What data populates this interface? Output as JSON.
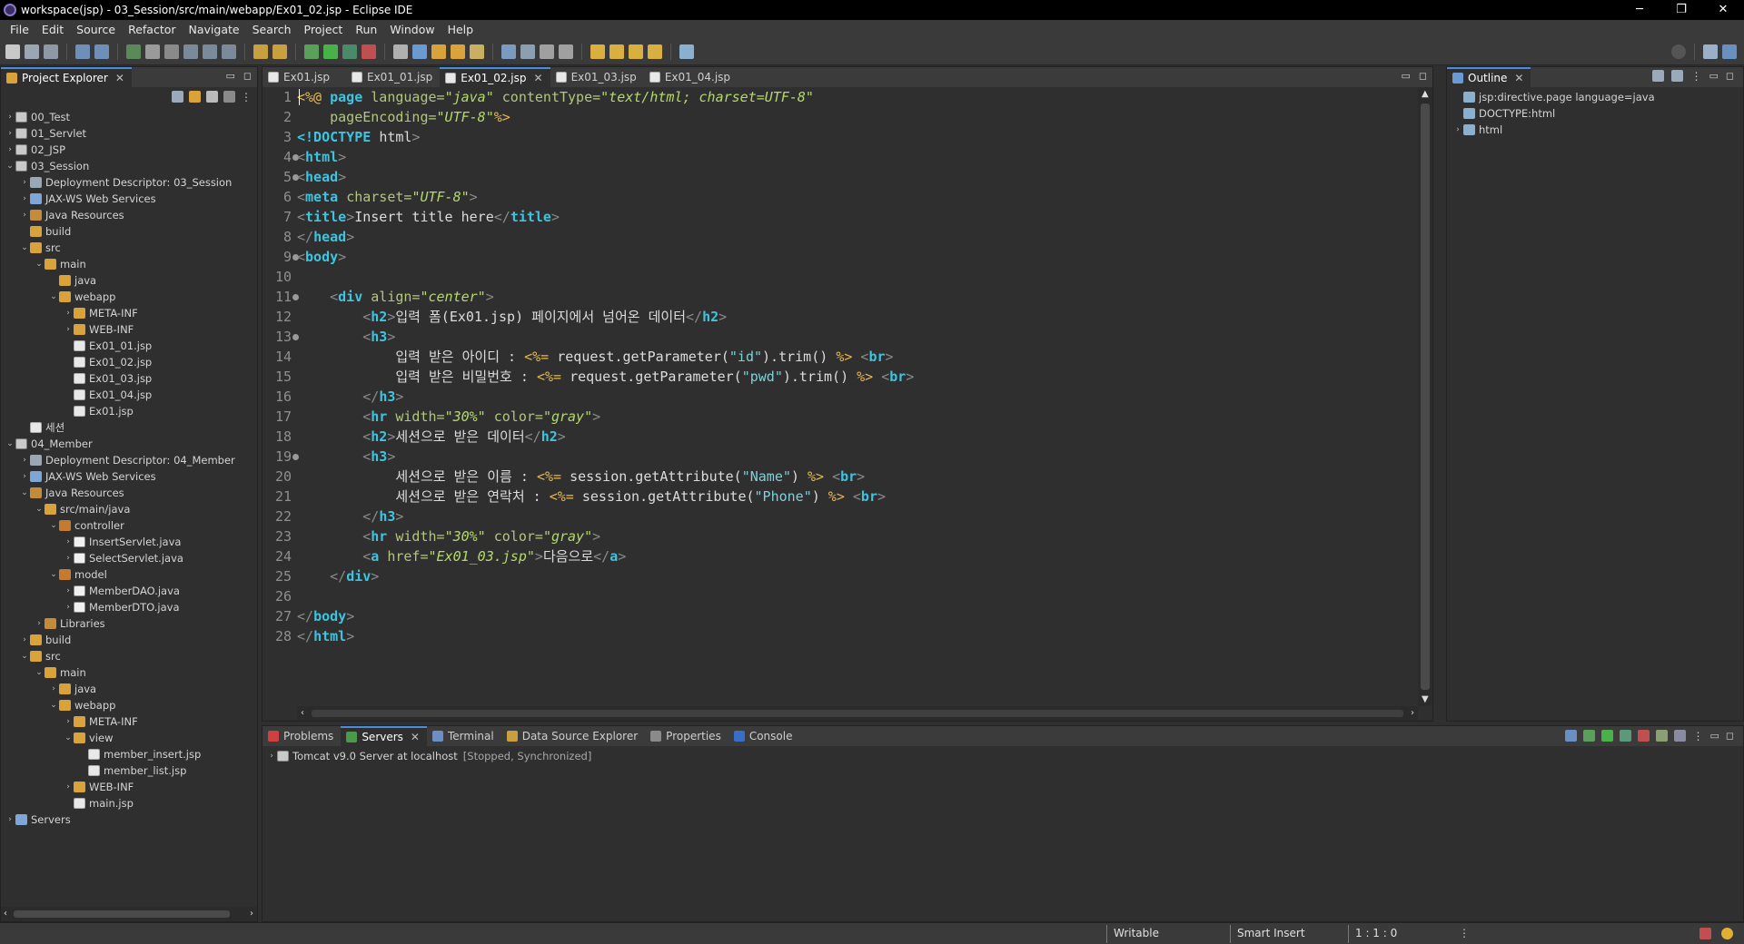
{
  "window": {
    "title": "workspace(jsp) - 03_Session/src/main/webapp/Ex01_02.jsp - Eclipse IDE",
    "controls": [
      "─",
      "❐",
      "✕"
    ]
  },
  "menu": [
    "File",
    "Edit",
    "Source",
    "Refactor",
    "Navigate",
    "Search",
    "Project",
    "Run",
    "Window",
    "Help"
  ],
  "project_explorer": {
    "title": "Project Explorer",
    "tree": [
      {
        "label": "00_Test",
        "indent": 0,
        "chev": "›",
        "icon": "proj"
      },
      {
        "label": "01_Servlet",
        "indent": 0,
        "chev": "›",
        "icon": "proj"
      },
      {
        "label": "02_JSP",
        "indent": 0,
        "chev": "›",
        "icon": "proj"
      },
      {
        "label": "03_Session",
        "indent": 0,
        "chev": "⌄",
        "icon": "proj"
      },
      {
        "label": "Deployment Descriptor: 03_Session",
        "indent": 1,
        "chev": "›",
        "icon": "dd"
      },
      {
        "label": "JAX-WS Web Services",
        "indent": 1,
        "chev": "›",
        "icon": "srv"
      },
      {
        "label": "Java Resources",
        "indent": 1,
        "chev": "›",
        "icon": "lib"
      },
      {
        "label": "build",
        "indent": 1,
        "chev": "",
        "icon": "folder"
      },
      {
        "label": "src",
        "indent": 1,
        "chev": "⌄",
        "icon": "folder"
      },
      {
        "label": "main",
        "indent": 2,
        "chev": "⌄",
        "icon": "folder"
      },
      {
        "label": "java",
        "indent": 3,
        "chev": "",
        "icon": "folder"
      },
      {
        "label": "webapp",
        "indent": 3,
        "chev": "⌄",
        "icon": "folder"
      },
      {
        "label": "META-INF",
        "indent": 4,
        "chev": "›",
        "icon": "folder"
      },
      {
        "label": "WEB-INF",
        "indent": 4,
        "chev": "›",
        "icon": "folder"
      },
      {
        "label": "Ex01_01.jsp",
        "indent": 4,
        "chev": "",
        "icon": "file-jsp"
      },
      {
        "label": "Ex01_02.jsp",
        "indent": 4,
        "chev": "",
        "icon": "file-jsp"
      },
      {
        "label": "Ex01_03.jsp",
        "indent": 4,
        "chev": "",
        "icon": "file-jsp"
      },
      {
        "label": "Ex01_04.jsp",
        "indent": 4,
        "chev": "",
        "icon": "file-jsp"
      },
      {
        "label": "Ex01.jsp",
        "indent": 4,
        "chev": "",
        "icon": "file-jsp"
      },
      {
        "label": "세션",
        "indent": 1,
        "chev": "",
        "icon": "file-jsp"
      },
      {
        "label": "04_Member",
        "indent": 0,
        "chev": "⌄",
        "icon": "proj"
      },
      {
        "label": "Deployment Descriptor: 04_Member",
        "indent": 1,
        "chev": "›",
        "icon": "dd"
      },
      {
        "label": "JAX-WS Web Services",
        "indent": 1,
        "chev": "›",
        "icon": "srv"
      },
      {
        "label": "Java Resources",
        "indent": 1,
        "chev": "⌄",
        "icon": "lib"
      },
      {
        "label": "src/main/java",
        "indent": 2,
        "chev": "⌄",
        "icon": "folder"
      },
      {
        "label": "controller",
        "indent": 3,
        "chev": "⌄",
        "icon": "pkg"
      },
      {
        "label": "InsertServlet.java",
        "indent": 4,
        "chev": "›",
        "icon": "file-java"
      },
      {
        "label": "SelectServlet.java",
        "indent": 4,
        "chev": "›",
        "icon": "file-java"
      },
      {
        "label": "model",
        "indent": 3,
        "chev": "⌄",
        "icon": "pkg"
      },
      {
        "label": "MemberDAO.java",
        "indent": 4,
        "chev": "›",
        "icon": "file-java"
      },
      {
        "label": "MemberDTO.java",
        "indent": 4,
        "chev": "›",
        "icon": "file-java"
      },
      {
        "label": "Libraries",
        "indent": 2,
        "chev": "›",
        "icon": "lib"
      },
      {
        "label": "build",
        "indent": 1,
        "chev": "›",
        "icon": "folder"
      },
      {
        "label": "src",
        "indent": 1,
        "chev": "⌄",
        "icon": "folder"
      },
      {
        "label": "main",
        "indent": 2,
        "chev": "⌄",
        "icon": "folder"
      },
      {
        "label": "java",
        "indent": 3,
        "chev": "›",
        "icon": "folder"
      },
      {
        "label": "webapp",
        "indent": 3,
        "chev": "⌄",
        "icon": "folder"
      },
      {
        "label": "META-INF",
        "indent": 4,
        "chev": "›",
        "icon": "folder"
      },
      {
        "label": "view",
        "indent": 4,
        "chev": "⌄",
        "icon": "folder"
      },
      {
        "label": "member_insert.jsp",
        "indent": 5,
        "chev": "",
        "icon": "file-jsp"
      },
      {
        "label": "member_list.jsp",
        "indent": 5,
        "chev": "",
        "icon": "file-jsp"
      },
      {
        "label": "WEB-INF",
        "indent": 4,
        "chev": "›",
        "icon": "folder"
      },
      {
        "label": "main.jsp",
        "indent": 4,
        "chev": "",
        "icon": "file-jsp"
      },
      {
        "label": "Servers",
        "indent": 0,
        "chev": "›",
        "icon": "srv"
      }
    ]
  },
  "editor": {
    "tabs": [
      {
        "label": "Ex01.jsp",
        "active": false
      },
      {
        "label": "Ex01_01.jsp",
        "active": false
      },
      {
        "label": "Ex01_02.jsp",
        "active": true
      },
      {
        "label": "Ex01_03.jsp",
        "active": false
      },
      {
        "label": "Ex01_04.jsp",
        "active": false
      }
    ],
    "fold_lines": [
      4,
      5,
      9,
      11,
      13,
      19
    ],
    "lines": [
      [
        [
          "jsp",
          "<%@ "
        ],
        [
          "dir",
          "page "
        ],
        [
          "attr",
          "language="
        ],
        [
          "val",
          "\"java\" "
        ],
        [
          "attr",
          "contentType="
        ],
        [
          "val",
          "\"text/html; charset=UTF-8\""
        ]
      ],
      [
        [
          "txt",
          "    "
        ],
        [
          "attr",
          "pageEncoding="
        ],
        [
          "val",
          "\"UTF-8\""
        ],
        [
          "jsp",
          "%>"
        ]
      ],
      [
        [
          "doc",
          "<!DOCTYPE "
        ],
        [
          "txt",
          "html"
        ],
        [
          "br",
          ">"
        ]
      ],
      [
        [
          "br",
          "<"
        ],
        [
          "tag",
          "html"
        ],
        [
          "br",
          ">"
        ]
      ],
      [
        [
          "br",
          "<"
        ],
        [
          "tag",
          "head"
        ],
        [
          "br",
          ">"
        ]
      ],
      [
        [
          "br",
          "<"
        ],
        [
          "tag",
          "meta "
        ],
        [
          "attr",
          "charset="
        ],
        [
          "val",
          "\"UTF-8\""
        ],
        [
          "br",
          ">"
        ]
      ],
      [
        [
          "br",
          "<"
        ],
        [
          "tag",
          "title"
        ],
        [
          "br",
          ">"
        ],
        [
          "txt",
          "Insert title here"
        ],
        [
          "br",
          "</"
        ],
        [
          "tag",
          "title"
        ],
        [
          "br",
          ">"
        ]
      ],
      [
        [
          "br",
          "</"
        ],
        [
          "tag",
          "head"
        ],
        [
          "br",
          ">"
        ]
      ],
      [
        [
          "br",
          "<"
        ],
        [
          "tag",
          "body"
        ],
        [
          "br",
          ">"
        ]
      ],
      [
        [
          "txt",
          ""
        ]
      ],
      [
        [
          "txt",
          "    "
        ],
        [
          "br",
          "<"
        ],
        [
          "tag",
          "div "
        ],
        [
          "attr",
          "align="
        ],
        [
          "val",
          "\"center\""
        ],
        [
          "br",
          ">"
        ]
      ],
      [
        [
          "txt",
          "        "
        ],
        [
          "br",
          "<"
        ],
        [
          "tag",
          "h2"
        ],
        [
          "br",
          ">"
        ],
        [
          "txt",
          "입력 폼(Ex01.jsp) 페이지에서 넘어온 데이터"
        ],
        [
          "br",
          "</"
        ],
        [
          "tag",
          "h2"
        ],
        [
          "br",
          ">"
        ]
      ],
      [
        [
          "txt",
          "        "
        ],
        [
          "br",
          "<"
        ],
        [
          "tag",
          "h3"
        ],
        [
          "br",
          ">"
        ]
      ],
      [
        [
          "txt",
          "            입력 받은 아이디 : "
        ],
        [
          "jsp",
          "<%= "
        ],
        [
          "txt",
          "request.getParameter("
        ],
        [
          "str",
          "\"id\""
        ],
        [
          "txt",
          ").trim() "
        ],
        [
          "jsp",
          "%> "
        ],
        [
          "br",
          "<"
        ],
        [
          "tag",
          "br"
        ],
        [
          "br",
          ">"
        ]
      ],
      [
        [
          "txt",
          "            입력 받은 비밀번호 : "
        ],
        [
          "jsp",
          "<%= "
        ],
        [
          "txt",
          "request.getParameter("
        ],
        [
          "str",
          "\"pwd\""
        ],
        [
          "txt",
          ").trim() "
        ],
        [
          "jsp",
          "%> "
        ],
        [
          "br",
          "<"
        ],
        [
          "tag",
          "br"
        ],
        [
          "br",
          ">"
        ]
      ],
      [
        [
          "txt",
          "        "
        ],
        [
          "br",
          "</"
        ],
        [
          "tag",
          "h3"
        ],
        [
          "br",
          ">"
        ]
      ],
      [
        [
          "txt",
          "        "
        ],
        [
          "br",
          "<"
        ],
        [
          "tag",
          "hr "
        ],
        [
          "attr",
          "width="
        ],
        [
          "val",
          "\"30%\" "
        ],
        [
          "attr",
          "color="
        ],
        [
          "val",
          "\"gray\""
        ],
        [
          "br",
          ">"
        ]
      ],
      [
        [
          "txt",
          "        "
        ],
        [
          "br",
          "<"
        ],
        [
          "tag",
          "h2"
        ],
        [
          "br",
          ">"
        ],
        [
          "txt",
          "세션으로 받은 데이터"
        ],
        [
          "br",
          "</"
        ],
        [
          "tag",
          "h2"
        ],
        [
          "br",
          ">"
        ]
      ],
      [
        [
          "txt",
          "        "
        ],
        [
          "br",
          "<"
        ],
        [
          "tag",
          "h3"
        ],
        [
          "br",
          ">"
        ]
      ],
      [
        [
          "txt",
          "            세션으로 받은 이름 : "
        ],
        [
          "jsp",
          "<%= "
        ],
        [
          "txt",
          "session.getAttribute("
        ],
        [
          "str",
          "\"Name\""
        ],
        [
          "txt",
          ") "
        ],
        [
          "jsp",
          "%> "
        ],
        [
          "br",
          "<"
        ],
        [
          "tag",
          "br"
        ],
        [
          "br",
          ">"
        ]
      ],
      [
        [
          "txt",
          "            세션으로 받은 연락처 : "
        ],
        [
          "jsp",
          "<%= "
        ],
        [
          "txt",
          "session.getAttribute("
        ],
        [
          "str",
          "\"Phone\""
        ],
        [
          "txt",
          ") "
        ],
        [
          "jsp",
          "%> "
        ],
        [
          "br",
          "<"
        ],
        [
          "tag",
          "br"
        ],
        [
          "br",
          ">"
        ]
      ],
      [
        [
          "txt",
          "        "
        ],
        [
          "br",
          "</"
        ],
        [
          "tag",
          "h3"
        ],
        [
          "br",
          ">"
        ]
      ],
      [
        [
          "txt",
          "        "
        ],
        [
          "br",
          "<"
        ],
        [
          "tag",
          "hr "
        ],
        [
          "attr",
          "width="
        ],
        [
          "val",
          "\"30%\" "
        ],
        [
          "attr",
          "color="
        ],
        [
          "val",
          "\"gray\""
        ],
        [
          "br",
          ">"
        ]
      ],
      [
        [
          "txt",
          "        "
        ],
        [
          "br",
          "<"
        ],
        [
          "tag",
          "a "
        ],
        [
          "attr",
          "href="
        ],
        [
          "val",
          "\"Ex01_03.jsp\""
        ],
        [
          "br",
          ">"
        ],
        [
          "txt",
          "다음으로"
        ],
        [
          "br",
          "</"
        ],
        [
          "tag",
          "a"
        ],
        [
          "br",
          ">"
        ]
      ],
      [
        [
          "txt",
          "    "
        ],
        [
          "br",
          "</"
        ],
        [
          "tag",
          "div"
        ],
        [
          "br",
          ">"
        ]
      ],
      [
        [
          "txt",
          ""
        ]
      ],
      [
        [
          "br",
          "</"
        ],
        [
          "tag",
          "body"
        ],
        [
          "br",
          ">"
        ]
      ],
      [
        [
          "br",
          "</"
        ],
        [
          "tag",
          "html"
        ],
        [
          "br",
          ">"
        ]
      ]
    ]
  },
  "outline": {
    "title": "Outline",
    "items": [
      {
        "label": "jsp:directive.page language=java",
        "chev": ""
      },
      {
        "label": "DOCTYPE:html",
        "chev": ""
      },
      {
        "label": "html",
        "chev": "›"
      }
    ]
  },
  "bottom": {
    "tabs": [
      {
        "label": "Problems",
        "active": false,
        "color": "#d04040"
      },
      {
        "label": "Servers",
        "active": true,
        "color": "#4a9a4a"
      },
      {
        "label": "Terminal",
        "active": false,
        "color": "#6b8fc4"
      },
      {
        "label": "Data Source Explorer",
        "active": false,
        "color": "#c9a040"
      },
      {
        "label": "Properties",
        "active": false,
        "color": "#8a8a8a"
      },
      {
        "label": "Console",
        "active": false,
        "color": "#3a6ec4"
      }
    ],
    "server_row": {
      "name": "Tomcat v9.0 Server at localhost",
      "status": "[Stopped, Synchronized]"
    }
  },
  "status": {
    "writable": "Writable",
    "insert_mode": "Smart Insert",
    "position": "1 : 1 : 0"
  },
  "colors": {
    "accent": "#4a8de0",
    "tag": "#3ec4e0",
    "attr_value": "#b5d96a",
    "jsp_delim": "#e6b850"
  }
}
